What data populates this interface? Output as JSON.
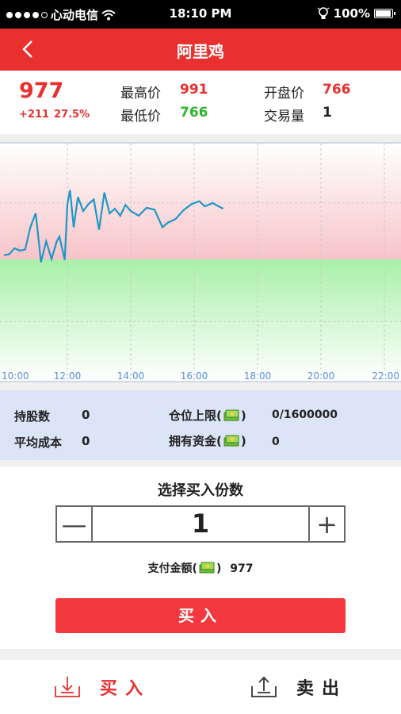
{
  "status_bar": {
    "carrier": "心动电信",
    "time": "18:10 PM",
    "battery": "100%"
  },
  "header": {
    "title": "阿里鸡"
  },
  "quote": {
    "price": "977",
    "change": "+211",
    "change_pct": "27.5%",
    "high_label": "最高价",
    "high_value": "991",
    "low_label": "最低价",
    "low_value": "766",
    "open_label": "开盘价",
    "open_value": "766",
    "volume_label": "交易量",
    "volume_value": "1"
  },
  "chart_data": {
    "type": "line",
    "x_ticks": [
      "10:00",
      "12:00",
      "14:00",
      "16:00",
      "18:00",
      "20:00",
      "22:00"
    ],
    "baseline": 766,
    "colors": {
      "line": "#1f97c6",
      "above": "#f7c4c8",
      "below": "#a8f0a8"
    },
    "series": [
      {
        "values": [
          [
            "10:00",
            760
          ],
          [
            "10:10",
            762
          ],
          [
            "10:20",
            775
          ],
          [
            "10:30",
            770
          ],
          [
            "10:40",
            772
          ],
          [
            "10:50",
            820
          ],
          [
            "11:00",
            850
          ],
          [
            "11:05",
            800
          ],
          [
            "11:10",
            745
          ],
          [
            "11:20",
            790
          ],
          [
            "11:30",
            752
          ],
          [
            "11:40",
            790
          ],
          [
            "11:45",
            800
          ],
          [
            "11:55",
            750
          ],
          [
            "12:00",
            870
          ],
          [
            "12:05",
            900
          ],
          [
            "12:12",
            820
          ],
          [
            "12:20",
            885
          ],
          [
            "12:30",
            855
          ],
          [
            "12:40",
            870
          ],
          [
            "12:50",
            880
          ],
          [
            "13:00",
            815
          ],
          [
            "13:10",
            895
          ],
          [
            "13:20",
            850
          ],
          [
            "13:30",
            860
          ],
          [
            "13:40",
            845
          ],
          [
            "13:50",
            868
          ],
          [
            "14:00",
            855
          ],
          [
            "14:15",
            845
          ],
          [
            "14:30",
            862
          ],
          [
            "14:45",
            858
          ],
          [
            "15:00",
            820
          ],
          [
            "15:10",
            830
          ],
          [
            "15:25",
            838
          ],
          [
            "15:40",
            857
          ],
          [
            "15:55",
            870
          ],
          [
            "16:10",
            876
          ],
          [
            "16:20",
            865
          ],
          [
            "16:35",
            872
          ],
          [
            "16:55",
            860
          ]
        ]
      }
    ]
  },
  "holdings": {
    "shares_label": "持股数",
    "shares_value": "0",
    "avg_cost_label": "平均成本",
    "avg_cost_value": "0",
    "position_limit_label_pre": "仓位上限(",
    "position_limit_label_post": ")",
    "position_limit_value": "0/1600000",
    "funds_label_pre": "拥有资金(",
    "funds_label_post": ")",
    "funds_value": "0"
  },
  "order": {
    "title": "选择买入份数",
    "quantity": "1",
    "minus": "—",
    "plus": "+",
    "pay_label_pre": "支付金额(",
    "pay_label_post": ")",
    "pay_value": "977",
    "buy_button": "买入"
  },
  "tabbar": {
    "buy_label": "买入",
    "sell_label": "卖出"
  }
}
